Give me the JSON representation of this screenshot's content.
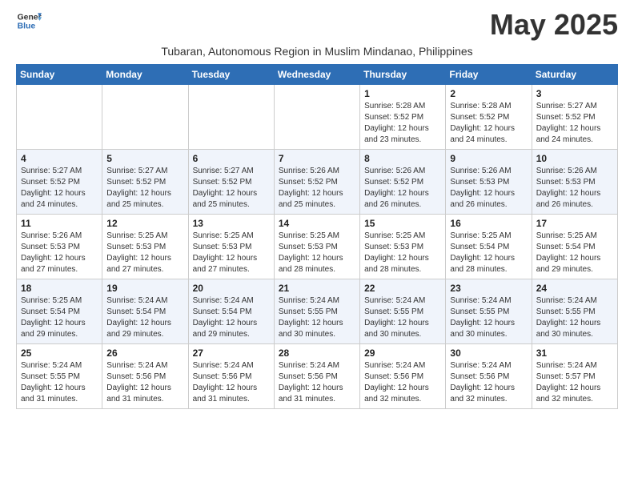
{
  "header": {
    "logo_general": "General",
    "logo_blue": "Blue",
    "month_title": "May 2025",
    "subtitle": "Tubaran, Autonomous Region in Muslim Mindanao, Philippines"
  },
  "days_of_week": [
    "Sunday",
    "Monday",
    "Tuesday",
    "Wednesday",
    "Thursday",
    "Friday",
    "Saturday"
  ],
  "weeks": [
    [
      {
        "day": "",
        "info": ""
      },
      {
        "day": "",
        "info": ""
      },
      {
        "day": "",
        "info": ""
      },
      {
        "day": "",
        "info": ""
      },
      {
        "day": "1",
        "info": "Sunrise: 5:28 AM\nSunset: 5:52 PM\nDaylight: 12 hours\nand 23 minutes."
      },
      {
        "day": "2",
        "info": "Sunrise: 5:28 AM\nSunset: 5:52 PM\nDaylight: 12 hours\nand 24 minutes."
      },
      {
        "day": "3",
        "info": "Sunrise: 5:27 AM\nSunset: 5:52 PM\nDaylight: 12 hours\nand 24 minutes."
      }
    ],
    [
      {
        "day": "4",
        "info": "Sunrise: 5:27 AM\nSunset: 5:52 PM\nDaylight: 12 hours\nand 24 minutes."
      },
      {
        "day": "5",
        "info": "Sunrise: 5:27 AM\nSunset: 5:52 PM\nDaylight: 12 hours\nand 25 minutes."
      },
      {
        "day": "6",
        "info": "Sunrise: 5:27 AM\nSunset: 5:52 PM\nDaylight: 12 hours\nand 25 minutes."
      },
      {
        "day": "7",
        "info": "Sunrise: 5:26 AM\nSunset: 5:52 PM\nDaylight: 12 hours\nand 25 minutes."
      },
      {
        "day": "8",
        "info": "Sunrise: 5:26 AM\nSunset: 5:52 PM\nDaylight: 12 hours\nand 26 minutes."
      },
      {
        "day": "9",
        "info": "Sunrise: 5:26 AM\nSunset: 5:53 PM\nDaylight: 12 hours\nand 26 minutes."
      },
      {
        "day": "10",
        "info": "Sunrise: 5:26 AM\nSunset: 5:53 PM\nDaylight: 12 hours\nand 26 minutes."
      }
    ],
    [
      {
        "day": "11",
        "info": "Sunrise: 5:26 AM\nSunset: 5:53 PM\nDaylight: 12 hours\nand 27 minutes."
      },
      {
        "day": "12",
        "info": "Sunrise: 5:25 AM\nSunset: 5:53 PM\nDaylight: 12 hours\nand 27 minutes."
      },
      {
        "day": "13",
        "info": "Sunrise: 5:25 AM\nSunset: 5:53 PM\nDaylight: 12 hours\nand 27 minutes."
      },
      {
        "day": "14",
        "info": "Sunrise: 5:25 AM\nSunset: 5:53 PM\nDaylight: 12 hours\nand 28 minutes."
      },
      {
        "day": "15",
        "info": "Sunrise: 5:25 AM\nSunset: 5:53 PM\nDaylight: 12 hours\nand 28 minutes."
      },
      {
        "day": "16",
        "info": "Sunrise: 5:25 AM\nSunset: 5:54 PM\nDaylight: 12 hours\nand 28 minutes."
      },
      {
        "day": "17",
        "info": "Sunrise: 5:25 AM\nSunset: 5:54 PM\nDaylight: 12 hours\nand 29 minutes."
      }
    ],
    [
      {
        "day": "18",
        "info": "Sunrise: 5:25 AM\nSunset: 5:54 PM\nDaylight: 12 hours\nand 29 minutes."
      },
      {
        "day": "19",
        "info": "Sunrise: 5:24 AM\nSunset: 5:54 PM\nDaylight: 12 hours\nand 29 minutes."
      },
      {
        "day": "20",
        "info": "Sunrise: 5:24 AM\nSunset: 5:54 PM\nDaylight: 12 hours\nand 29 minutes."
      },
      {
        "day": "21",
        "info": "Sunrise: 5:24 AM\nSunset: 5:55 PM\nDaylight: 12 hours\nand 30 minutes."
      },
      {
        "day": "22",
        "info": "Sunrise: 5:24 AM\nSunset: 5:55 PM\nDaylight: 12 hours\nand 30 minutes."
      },
      {
        "day": "23",
        "info": "Sunrise: 5:24 AM\nSunset: 5:55 PM\nDaylight: 12 hours\nand 30 minutes."
      },
      {
        "day": "24",
        "info": "Sunrise: 5:24 AM\nSunset: 5:55 PM\nDaylight: 12 hours\nand 30 minutes."
      }
    ],
    [
      {
        "day": "25",
        "info": "Sunrise: 5:24 AM\nSunset: 5:55 PM\nDaylight: 12 hours\nand 31 minutes."
      },
      {
        "day": "26",
        "info": "Sunrise: 5:24 AM\nSunset: 5:56 PM\nDaylight: 12 hours\nand 31 minutes."
      },
      {
        "day": "27",
        "info": "Sunrise: 5:24 AM\nSunset: 5:56 PM\nDaylight: 12 hours\nand 31 minutes."
      },
      {
        "day": "28",
        "info": "Sunrise: 5:24 AM\nSunset: 5:56 PM\nDaylight: 12 hours\nand 31 minutes."
      },
      {
        "day": "29",
        "info": "Sunrise: 5:24 AM\nSunset: 5:56 PM\nDaylight: 12 hours\nand 32 minutes."
      },
      {
        "day": "30",
        "info": "Sunrise: 5:24 AM\nSunset: 5:56 PM\nDaylight: 12 hours\nand 32 minutes."
      },
      {
        "day": "31",
        "info": "Sunrise: 5:24 AM\nSunset: 5:57 PM\nDaylight: 12 hours\nand 32 minutes."
      }
    ]
  ]
}
